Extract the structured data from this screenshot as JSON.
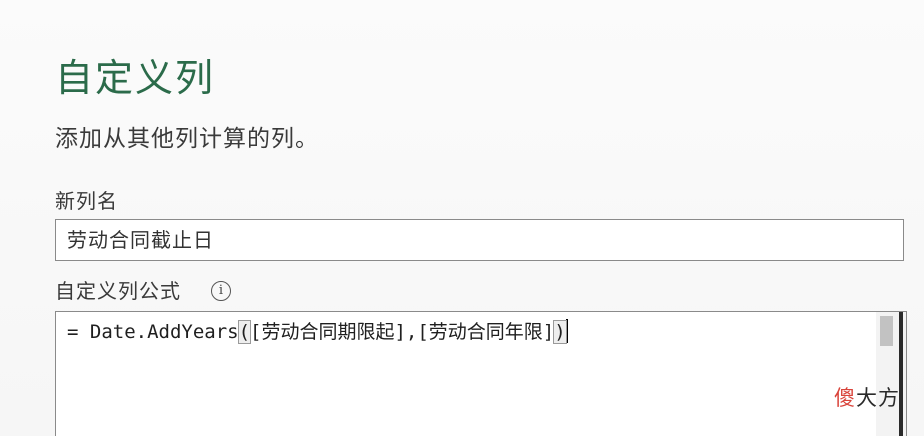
{
  "dialog": {
    "title": "自定义列",
    "description": "添加从其他列计算的列。",
    "title_color": "#2b6b4a"
  },
  "new_column": {
    "label": "新列名",
    "value": "劳动合同截止日"
  },
  "formula": {
    "label": "自定义列公式",
    "info_icon": "info-icon",
    "info_glyph": "i",
    "prefix": "= Date.AddYears",
    "open_paren": "(",
    "args": "[劳动合同期限起],[劳动合同年限]",
    "close_paren": ")"
  },
  "watermark": {
    "accent_char": "傻",
    "rest": "大方",
    "accent_color": "#d9433a"
  }
}
